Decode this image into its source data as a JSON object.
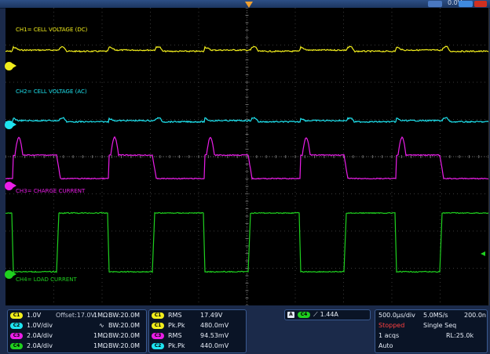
{
  "channels": [
    {
      "id": "1",
      "label": "CH1= CELL VOLTAGE (DC)",
      "color": "#f2ee1c"
    },
    {
      "id": "2",
      "label": "CH2= CELL VOLTAGE (AC)",
      "color": "#1ee4f0"
    },
    {
      "id": "3",
      "label": "CH3= CHARGE CURRENT",
      "color": "#ea1ee8"
    },
    {
      "id": "4",
      "label": "CH4= LOAD CURRENT",
      "color": "#1fd11f"
    }
  ],
  "vertical": [
    {
      "badge": "C1",
      "scale": "1.0V",
      "offset": "Offset:17.0V",
      "imp": "1MΩ",
      "bw": "BW:20.0M"
    },
    {
      "badge": "C2",
      "scale": "1.0V/div",
      "offset": "",
      "imp": "∿",
      "bw": "BW:20.0M"
    },
    {
      "badge": "C3",
      "scale": "2.0A/div",
      "offset": "",
      "imp": "1MΩ",
      "bw": "BW:20.0M"
    },
    {
      "badge": "C4",
      "scale": "2.0A/div",
      "offset": "",
      "imp": "1MΩ",
      "bw": "BW:20.0M"
    }
  ],
  "measurements": [
    {
      "badge": "C1",
      "type": "RMS",
      "value": "17.49V"
    },
    {
      "badge": "C1",
      "type": "Pk.Pk",
      "value": "480.0mV"
    },
    {
      "badge": "C3",
      "type": "RMS",
      "value": "94.53mV"
    },
    {
      "badge": "C2",
      "type": "Pk.Pk",
      "value": "440.0mV"
    }
  ],
  "trigger": {
    "badge_a": "A",
    "badge_ch": "C4",
    "slope": "⟋",
    "level": "1.44A"
  },
  "acquisition": {
    "timebase": "500.0µs/div",
    "sample_rate": "5.0MS/s",
    "delay": "200.0n",
    "state": "Stopped",
    "mode": "Single Seq",
    "acqs": "1 acqs",
    "record": "RL:25.0k",
    "trig_mode": "Auto"
  },
  "topbar": {
    "value_right": "0.0V"
  },
  "colors": {
    "ch1": "#f2ee1c",
    "ch2": "#1ee4f0",
    "ch3": "#ea1ee8",
    "ch4": "#1fd11f",
    "stopped": "#ff4040",
    "accent": "#3a5a90"
  }
}
